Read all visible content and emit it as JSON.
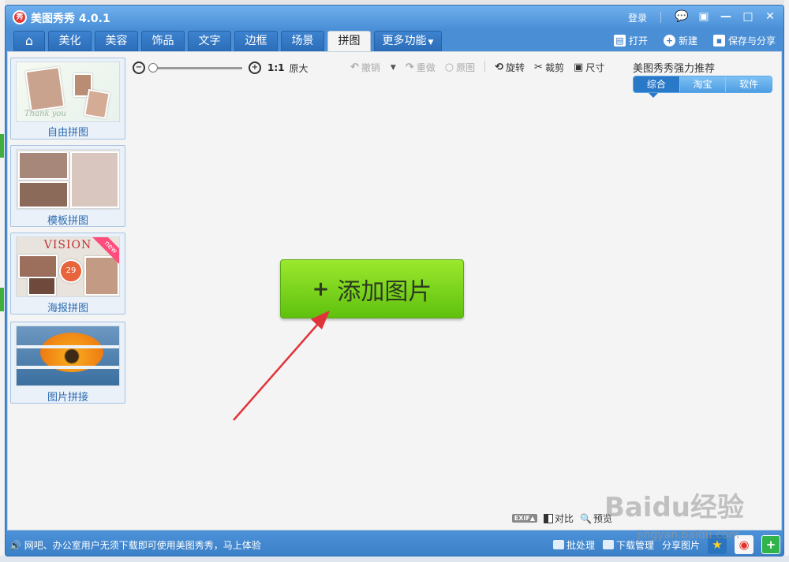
{
  "window": {
    "app_title": "美图秀秀 4.0.1",
    "logo_glyph": "秀",
    "login": "登录"
  },
  "tabs": [
    "美化",
    "美容",
    "饰品",
    "文字",
    "边框",
    "场景",
    "拼图"
  ],
  "active_tab": "拼图",
  "more_tab": "更多功能",
  "toolbar_actions": {
    "open": "打开",
    "new": "新建",
    "save_share": "保存与分享"
  },
  "sidebar": {
    "items": [
      {
        "label": "自由拼图",
        "script": "Thank you"
      },
      {
        "label": "模板拼图"
      },
      {
        "label": "海报拼图",
        "heading": "VISION",
        "badge": "new",
        "number": "29"
      },
      {
        "label": "图片拼接"
      }
    ]
  },
  "edit_toolbar": {
    "ratio": "1:1",
    "original_size": "原大",
    "undo": "撤销",
    "redo": "重做",
    "original": "原图",
    "rotate": "旋转",
    "crop": "裁剪",
    "size": "尺寸"
  },
  "recommend": {
    "title": "美图秀秀强力推荐",
    "tabs": [
      "综合",
      "淘宝",
      "软件"
    ],
    "active": "综合"
  },
  "canvas": {
    "add_picture": "添加图片",
    "exif": "EXIF▲",
    "compare": "对比",
    "preview": "预览"
  },
  "statusbar": {
    "message": "网吧、办公室用户无须下载即可使用美图秀秀，马上体验",
    "batch": "批处理",
    "download_manager": "下载管理",
    "share_picture": "分享图片"
  },
  "watermark": {
    "main": "Baidu经验",
    "sub": "jingyan.baidu.com"
  },
  "colors": {
    "window_blue": "#4a8fd6",
    "add_button_green": "#7cd41f",
    "arrow_red": "#e0343a"
  }
}
